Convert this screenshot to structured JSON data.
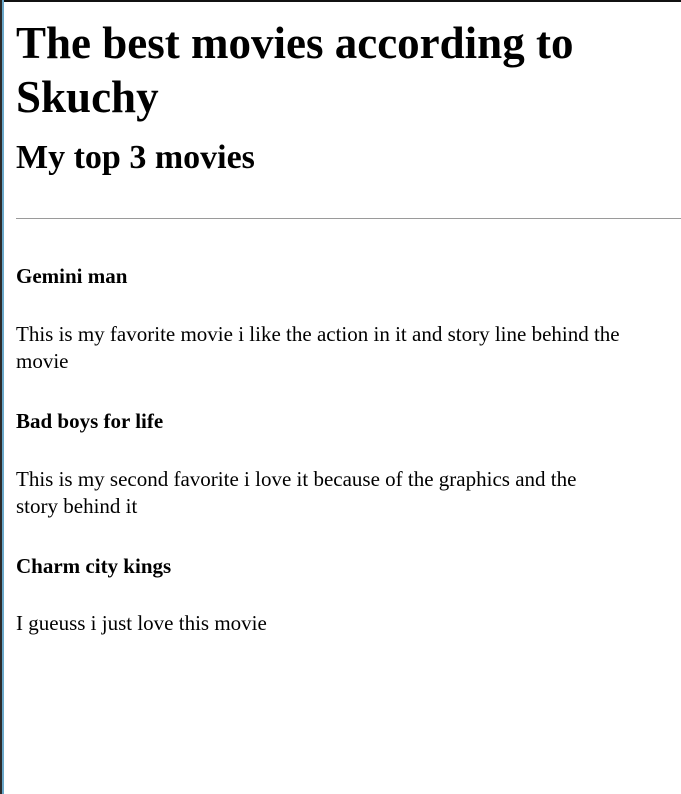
{
  "page": {
    "title": "The best movies according to Skuchy",
    "subtitle": "My top 3 movies"
  },
  "movies": [
    {
      "title": "Gemini man",
      "description_line1": "This is my favorite movie i like the action in it and story line behind the",
      "description_line2": "movie"
    },
    {
      "title": "Bad boys for life",
      "description_line1": "This is my second favorite i love it because of the graphics and the",
      "description_line2": "story behind it"
    },
    {
      "title": "Charm city kings",
      "description_line1": "I gueuss i just love this movie",
      "description_line2": ""
    }
  ]
}
